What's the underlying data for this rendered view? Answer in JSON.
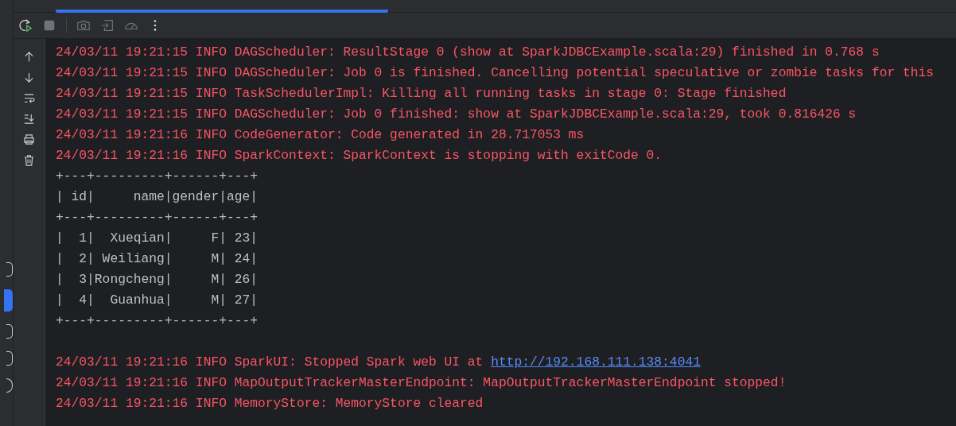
{
  "tab_strip": {
    "tabs": [
      {
        "selected": true
      }
    ]
  },
  "toolbar": [
    {
      "kind": "rerun",
      "disabled": false
    },
    {
      "kind": "stop",
      "disabled": true
    },
    {
      "kind": "separator"
    },
    {
      "kind": "camera",
      "disabled": true
    },
    {
      "kind": "exit",
      "disabled": true
    },
    {
      "kind": "gauge",
      "disabled": true
    },
    {
      "kind": "more",
      "disabled": false
    }
  ],
  "side_tools": [
    {
      "kind": "up"
    },
    {
      "kind": "down"
    },
    {
      "kind": "wrap"
    },
    {
      "kind": "scroll-end"
    },
    {
      "kind": "print"
    },
    {
      "kind": "trash"
    }
  ],
  "console": [
    {
      "kind": "log",
      "text": "24/03/11 19:21:15 INFO DAGScheduler: ResultStage 0 (show at SparkJDBCExample.scala:29) finished in 0.768 s"
    },
    {
      "kind": "log",
      "text": "24/03/11 19:21:15 INFO DAGScheduler: Job 0 is finished. Cancelling potential speculative or zombie tasks for this"
    },
    {
      "kind": "log",
      "text": "24/03/11 19:21:15 INFO TaskSchedulerImpl: Killing all running tasks in stage 0: Stage finished"
    },
    {
      "kind": "log",
      "text": "24/03/11 19:21:15 INFO DAGScheduler: Job 0 finished: show at SparkJDBCExample.scala:29, took 0.816426 s"
    },
    {
      "kind": "log",
      "text": "24/03/11 19:21:16 INFO CodeGenerator: Code generated in 28.717053 ms"
    },
    {
      "kind": "log",
      "text": "24/03/11 19:21:16 INFO SparkContext: SparkContext is stopping with exitCode 0."
    },
    {
      "kind": "output",
      "text": "+---+---------+------+---+"
    },
    {
      "kind": "output",
      "text": "| id|     name|gender|age|"
    },
    {
      "kind": "output",
      "text": "+---+---------+------+---+"
    },
    {
      "kind": "output",
      "text": "|  1|  Xueqian|     F| 23|"
    },
    {
      "kind": "output",
      "text": "|  2| Weiliang|     M| 24|"
    },
    {
      "kind": "output",
      "text": "|  3|Rongcheng|     M| 26|"
    },
    {
      "kind": "output",
      "text": "|  4|  Guanhua|     M| 27|"
    },
    {
      "kind": "output",
      "text": "+---+---------+------+---+"
    },
    {
      "kind": "blank"
    },
    {
      "kind": "log",
      "text": "24/03/11 19:21:16 INFO SparkUI: Stopped Spark web UI at ",
      "link": "http://192.168.111.138:4041"
    },
    {
      "kind": "log",
      "text": "24/03/11 19:21:16 INFO MapOutputTrackerMasterEndpoint: MapOutputTrackerMasterEndpoint stopped!"
    },
    {
      "kind": "log",
      "text": "24/03/11 19:21:16 INFO MemoryStore: MemoryStore cleared"
    }
  ]
}
